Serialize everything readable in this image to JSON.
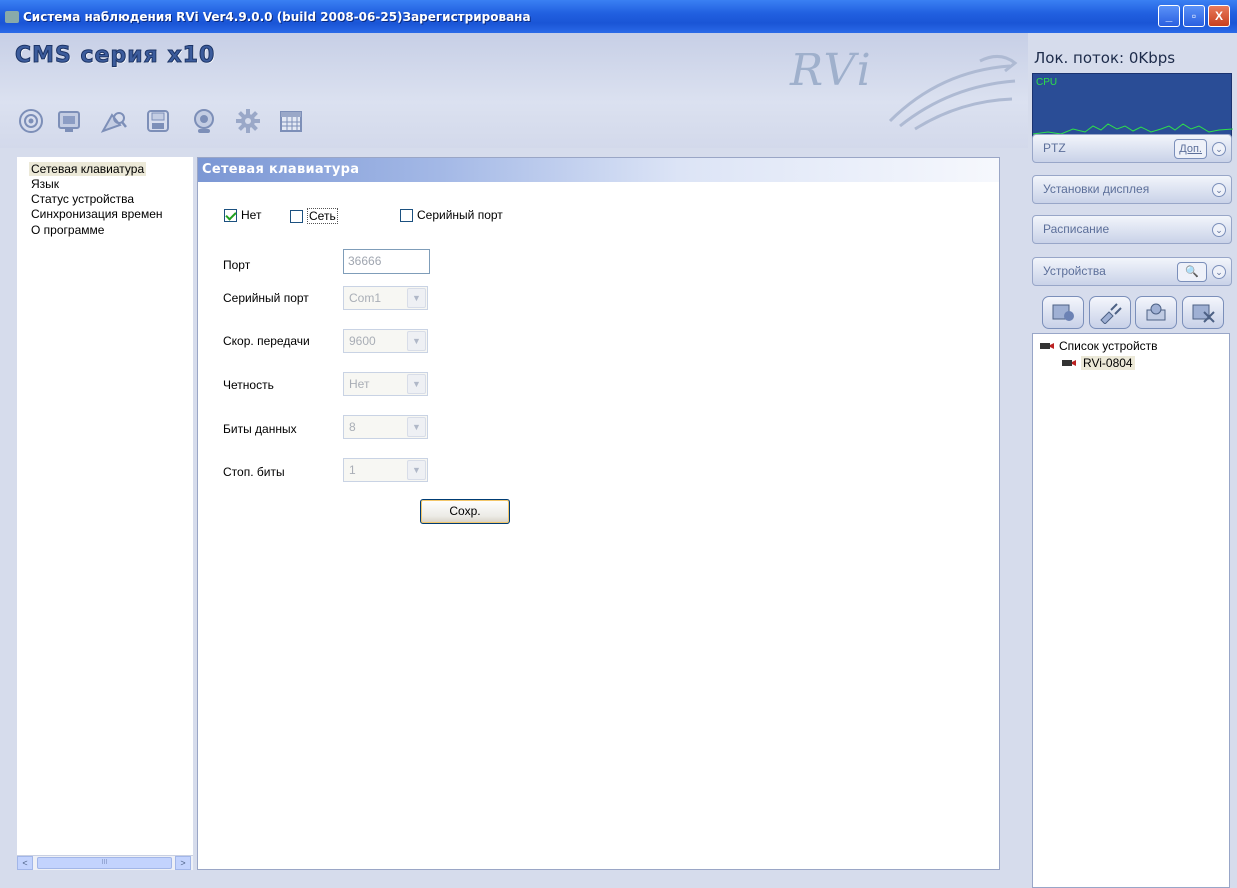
{
  "window": {
    "title": "Система наблюдения RVi  Ver4.9.0.0 (build 2008-06-25)Зарегистрирована",
    "minimize_label": "_",
    "maximize_label": "▫",
    "close_label": "X"
  },
  "header": {
    "logo": "CMS серия x10",
    "brand": "RVi",
    "toolbar_icons": [
      "eye-icon",
      "monitor-icon",
      "search-icon",
      "save-icon",
      "webcam-icon",
      "gear-icon",
      "calendar-icon"
    ]
  },
  "left_nav": {
    "items": [
      {
        "label": "Сетевая клавиатура",
        "selected": true
      },
      {
        "label": "Язык",
        "selected": false
      },
      {
        "label": "Статус устройства",
        "selected": false
      },
      {
        "label": "Синхронизация времен",
        "selected": false
      },
      {
        "label": "О программе",
        "selected": false
      }
    ],
    "scroll_left": "<",
    "scroll_right": ">",
    "thumb_grip": "III"
  },
  "content": {
    "title": "Сетевая клавиатура",
    "checkboxes": [
      {
        "label": "Нет",
        "checked": true
      },
      {
        "label": "Сеть",
        "checked": false
      },
      {
        "label": "Серийный порт",
        "checked": false
      }
    ],
    "fields": {
      "port": {
        "label": "Порт",
        "value": "36666"
      },
      "serial_port": {
        "label": "Серийный порт",
        "value": "Com1"
      },
      "baud": {
        "label": "Скор. передачи",
        "value": "9600"
      },
      "parity": {
        "label": "Четность",
        "value": "Нет"
      },
      "data_bits": {
        "label": "Биты данных",
        "value": "8"
      },
      "stop_bits": {
        "label": "Стоп. биты",
        "value": "1"
      }
    },
    "save_label": "Сохр."
  },
  "right_panel": {
    "stream": "Лок. поток: 0Kbps",
    "cpu_label": "CPU",
    "ptz": {
      "label": "PTZ",
      "extra": "Доп."
    },
    "display": {
      "label": "Установки дисплея"
    },
    "schedule": {
      "label": "Расписание"
    },
    "devices": {
      "label": "Устройства"
    },
    "device_tree": {
      "root": "Список устройств",
      "child": "RVi-0804"
    }
  },
  "colors": {
    "titlebar": "#2160e0",
    "cpu_bg": "#2a4d96",
    "cpu_line": "#2ee04a",
    "header_gradient_start": "#7b97d4"
  }
}
